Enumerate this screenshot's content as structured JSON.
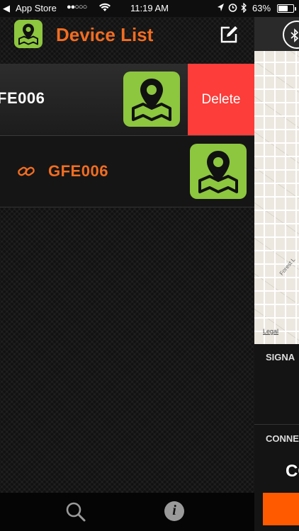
{
  "status_bar": {
    "back": "◀",
    "app": "App Store",
    "signal": "●●○○○",
    "wifi": "wifi-icon",
    "time": "11:19 AM",
    "location": "location-arrow-icon",
    "alarm": "alarm-icon",
    "bluetooth": "bluetooth-icon",
    "battery_pct": "63%",
    "battery_level": 0.63
  },
  "header": {
    "title": "Device List",
    "app_icon": "map-pin-icon",
    "edit_icon": "edit-icon"
  },
  "devices": [
    {
      "name": "FE006",
      "delete_label": "Delete",
      "icon": "map-pin-icon",
      "swiped": true
    },
    {
      "name": "GFE006",
      "icon": "map-pin-icon",
      "link_icon": "link-icon",
      "swiped": false
    }
  ],
  "bottom_bar": {
    "search_icon": "search-icon",
    "info_icon": "info-icon",
    "info_glyph": "i"
  },
  "right_panel": {
    "map_road": "Forest L",
    "map_legal": "Legal",
    "signal_label": "SIGNA",
    "connect_label": "CONNE",
    "value": "CO"
  },
  "colors": {
    "accent": "#f26d21",
    "icon_green": "#8dc63f",
    "delete_red": "#fc3d39",
    "button_orange": "#ff5a00"
  }
}
